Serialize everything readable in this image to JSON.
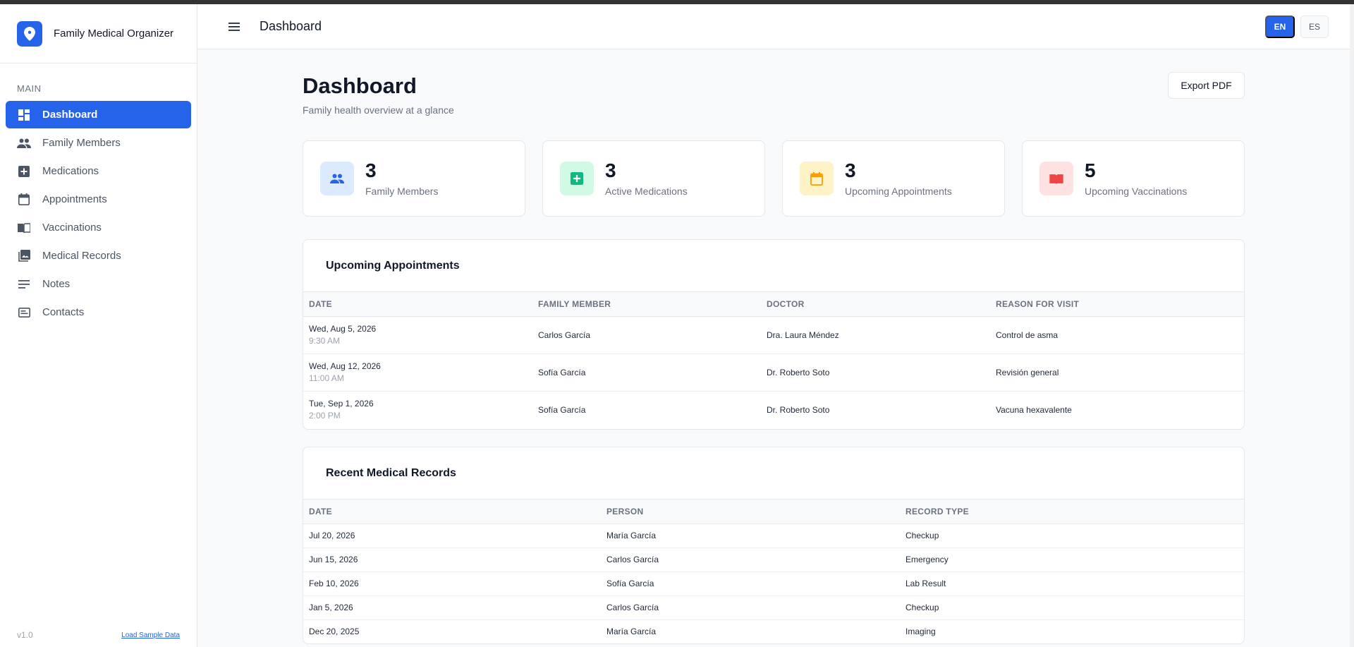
{
  "app": {
    "title": "Family Medical Organizer",
    "version": "v1.0",
    "load_sample_label": "Load Sample Data"
  },
  "sidebar": {
    "section": "MAIN",
    "items": [
      {
        "label": "Dashboard",
        "icon": "dashboard-icon",
        "active": true
      },
      {
        "label": "Family Members",
        "icon": "people-icon"
      },
      {
        "label": "Medications",
        "icon": "medical-plus-icon"
      },
      {
        "label": "Appointments",
        "icon": "calendar-icon"
      },
      {
        "label": "Vaccinations",
        "icon": "book-icon"
      },
      {
        "label": "Medical Records",
        "icon": "photo-library-icon"
      },
      {
        "label": "Notes",
        "icon": "notes-icon"
      },
      {
        "label": "Contacts",
        "icon": "contact-card-icon"
      }
    ]
  },
  "header": {
    "title": "Dashboard",
    "lang_en": "EN",
    "lang_es": "ES",
    "active_lang": "EN"
  },
  "page": {
    "title": "Dashboard",
    "subtitle": "Family health overview at a glance",
    "export_label": "Export PDF"
  },
  "stats": [
    {
      "value": "3",
      "label": "Family Members",
      "icon": "people-icon",
      "bg": "#dbeafe",
      "fg": "#2563eb"
    },
    {
      "value": "3",
      "label": "Active Medications",
      "icon": "medical-plus-icon",
      "bg": "#d1fae5",
      "fg": "#10b981"
    },
    {
      "value": "3",
      "label": "Upcoming Appointments",
      "icon": "calendar-icon",
      "bg": "#fef3c7",
      "fg": "#f59e0b"
    },
    {
      "value": "5",
      "label": "Upcoming Vaccinations",
      "icon": "book-icon",
      "bg": "#fee2e2",
      "fg": "#ef4444"
    }
  ],
  "appointments": {
    "title": "Upcoming Appointments",
    "columns": [
      "DATE",
      "FAMILY MEMBER",
      "DOCTOR",
      "REASON FOR VISIT"
    ],
    "rows": [
      {
        "date": "Wed, Aug 5, 2026",
        "time": "9:30 AM",
        "member": "Carlos García",
        "doctor": "Dra. Laura Méndez",
        "reason": "Control de asma"
      },
      {
        "date": "Wed, Aug 12, 2026",
        "time": "11:00 AM",
        "member": "Sofía García",
        "doctor": "Dr. Roberto Soto",
        "reason": "Revisión general"
      },
      {
        "date": "Tue, Sep 1, 2026",
        "time": "2:00 PM",
        "member": "Sofía García",
        "doctor": "Dr. Roberto Soto",
        "reason": "Vacuna hexavalente"
      }
    ]
  },
  "records": {
    "title": "Recent Medical Records",
    "columns": [
      "DATE",
      "PERSON",
      "RECORD TYPE"
    ],
    "rows": [
      {
        "date": "Jul 20, 2026",
        "person": "María García",
        "type": "Checkup"
      },
      {
        "date": "Jun 15, 2026",
        "person": "Carlos García",
        "type": "Emergency"
      },
      {
        "date": "Feb 10, 2026",
        "person": "Sofía García",
        "type": "Lab Result"
      },
      {
        "date": "Jan 5, 2026",
        "person": "Carlos García",
        "type": "Checkup"
      },
      {
        "date": "Dec 20, 2025",
        "person": "María García",
        "type": "Imaging"
      }
    ]
  },
  "colors": {
    "accent": "#2563eb",
    "text": "#111827",
    "muted": "#6b7280"
  }
}
